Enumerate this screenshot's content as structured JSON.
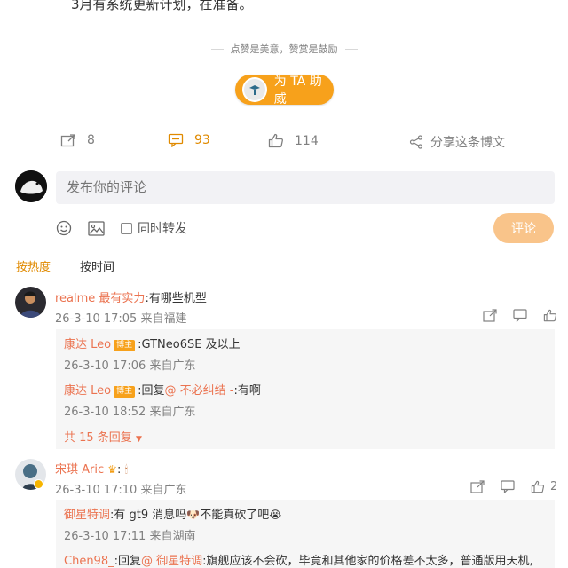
{
  "post": {
    "tail_text": "3月有系统更新计划，在准备。",
    "praise_text": "点赞是美意，赞赏是鼓励",
    "reward_button": "为 TA 助威"
  },
  "actions": {
    "repost_count": "8",
    "comment_count": "93",
    "like_count": "114",
    "share_label": "分享这条博文"
  },
  "composer": {
    "placeholder": "发布你的评论",
    "same_time_repost": "同时转发",
    "submit": "评论"
  },
  "sort": {
    "hot": "按热度",
    "time": "按时间"
  },
  "comments": [
    {
      "user": "realme 最有实力",
      "text": ":有哪些机型",
      "meta": "26-3-10 17:05 来自福建",
      "replies": [
        {
          "user": "康达 Leo",
          "badge": "博主",
          "text": ":GTNeo6SE 及以上",
          "meta": "26-3-10 17:06 来自广东"
        },
        {
          "user": "康达 Leo",
          "badge": "博主",
          "text_prefix": ":回复",
          "mention": "@ 不必纠结 -",
          "text_suffix": ":有啊",
          "meta": "26-3-10 18:52 来自广东"
        }
      ],
      "more": "共 15 条回复"
    },
    {
      "user": "宋琪 Aric",
      "text": ":",
      "meta": "26-3-10 17:10 来自广东",
      "like_count": "2",
      "replies": [
        {
          "user": "御星特调",
          "text": ":有 gt9 消息吗",
          "text_tail": "不能真砍了吧",
          "meta": "26-3-10 17:11 来自湖南"
        },
        {
          "user": "Chen98_",
          "text_prefix": ":回复",
          "mention": "@ 御星特调",
          "text_suffix": ":旗舰应该不会砍，毕竟和其他家的价格差不太多，普通版用天机,",
          "meta": ""
        }
      ]
    }
  ],
  "colors": {
    "accent": "#f7a11b",
    "highlight": "#e08a00",
    "username": "#eb7350",
    "submit_disabled": "#f9c48a"
  }
}
